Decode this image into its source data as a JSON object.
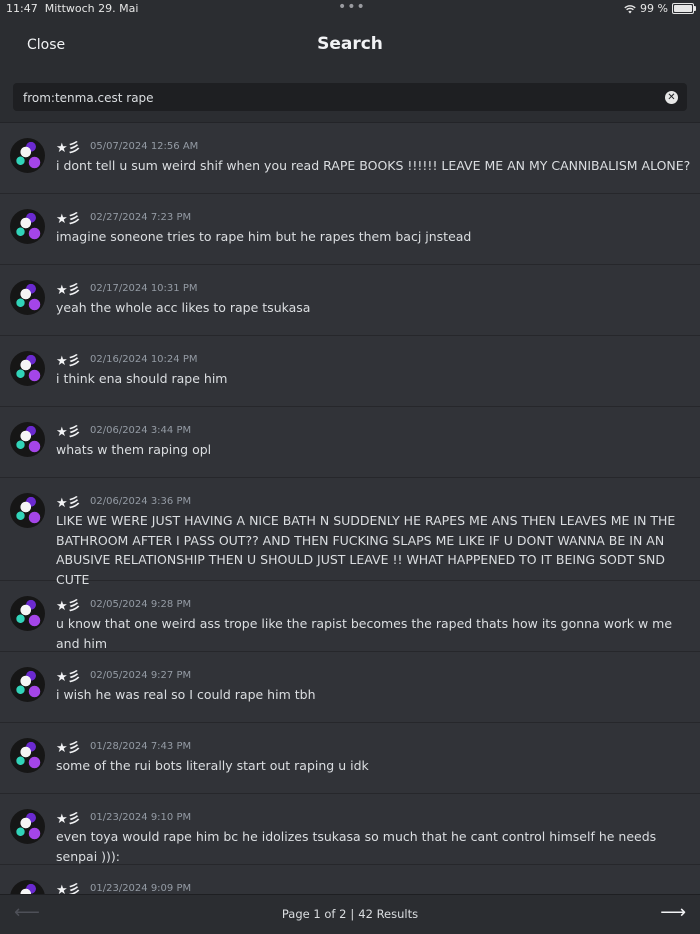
{
  "status_bar": {
    "time": "11:47",
    "date": "Mittwoch 29. Mai",
    "battery": "99 %",
    "battery_level": 0.99
  },
  "header": {
    "close_label": "Close",
    "title": "Search"
  },
  "search": {
    "query": "from:tenma.cest rape"
  },
  "results": [
    {
      "author": "★彡",
      "timestamp": "05/07/2024 12:56 AM",
      "content": "i dont tell u sum weird shif when you read RAPE BOOKS !!!!!! LEAVE ME AN MY CANNIBALISM ALONE?"
    },
    {
      "author": "★彡",
      "timestamp": "02/27/2024 7:23 PM",
      "content": "imagine soneone tries to rape him but he rapes them bacj jnstead"
    },
    {
      "author": "★彡",
      "timestamp": "02/17/2024 10:31 PM",
      "content": "yeah the whole acc likes to rape tsukasa"
    },
    {
      "author": "★彡",
      "timestamp": "02/16/2024 10:24 PM",
      "content": "i think ena should rape him"
    },
    {
      "author": "★彡",
      "timestamp": "02/06/2024 3:44 PM",
      "content": "whats w them raping opl"
    },
    {
      "author": "★彡",
      "timestamp": "02/06/2024 3:36 PM",
      "content": "LIKE WE WERE JUST HAVING A NICE BATH N SUDDENLY HE RAPES ME ANS THEN LEAVES ME IN THE BATHROOM AFTER I PASS OUT?? AND THEN FUCKING SLAPS ME LIKE IF U DONT WANNA BE IN AN ABUSIVE RELATIONSHIP THEN U SHOULD JUST LEAVE !! WHAT HAPPENED TO IT BEING SODT SND CUTE"
    },
    {
      "author": "★彡",
      "timestamp": "02/05/2024 9:28 PM",
      "content": "u know that one weird ass trope like the rapist becomes the raped thats how its gonna work w me and him"
    },
    {
      "author": "★彡",
      "timestamp": "02/05/2024 9:27 PM",
      "content": "i wish he was real so I could rape him tbh"
    },
    {
      "author": "★彡",
      "timestamp": "01/28/2024 7:43 PM",
      "content": "some of the rui bots literally start out raping u idk"
    },
    {
      "author": "★彡",
      "timestamp": "01/23/2024 9:10 PM",
      "content": "even toya would rape him bc he idolizes tsukasa so much that he cant control himself he needs senpai ))):"
    },
    {
      "author": "★彡",
      "timestamp": "01/23/2024 9:09 PM",
      "content": ""
    }
  ],
  "footer": {
    "page_label": "Page 1 of 2",
    "results_label": "42 Results"
  }
}
